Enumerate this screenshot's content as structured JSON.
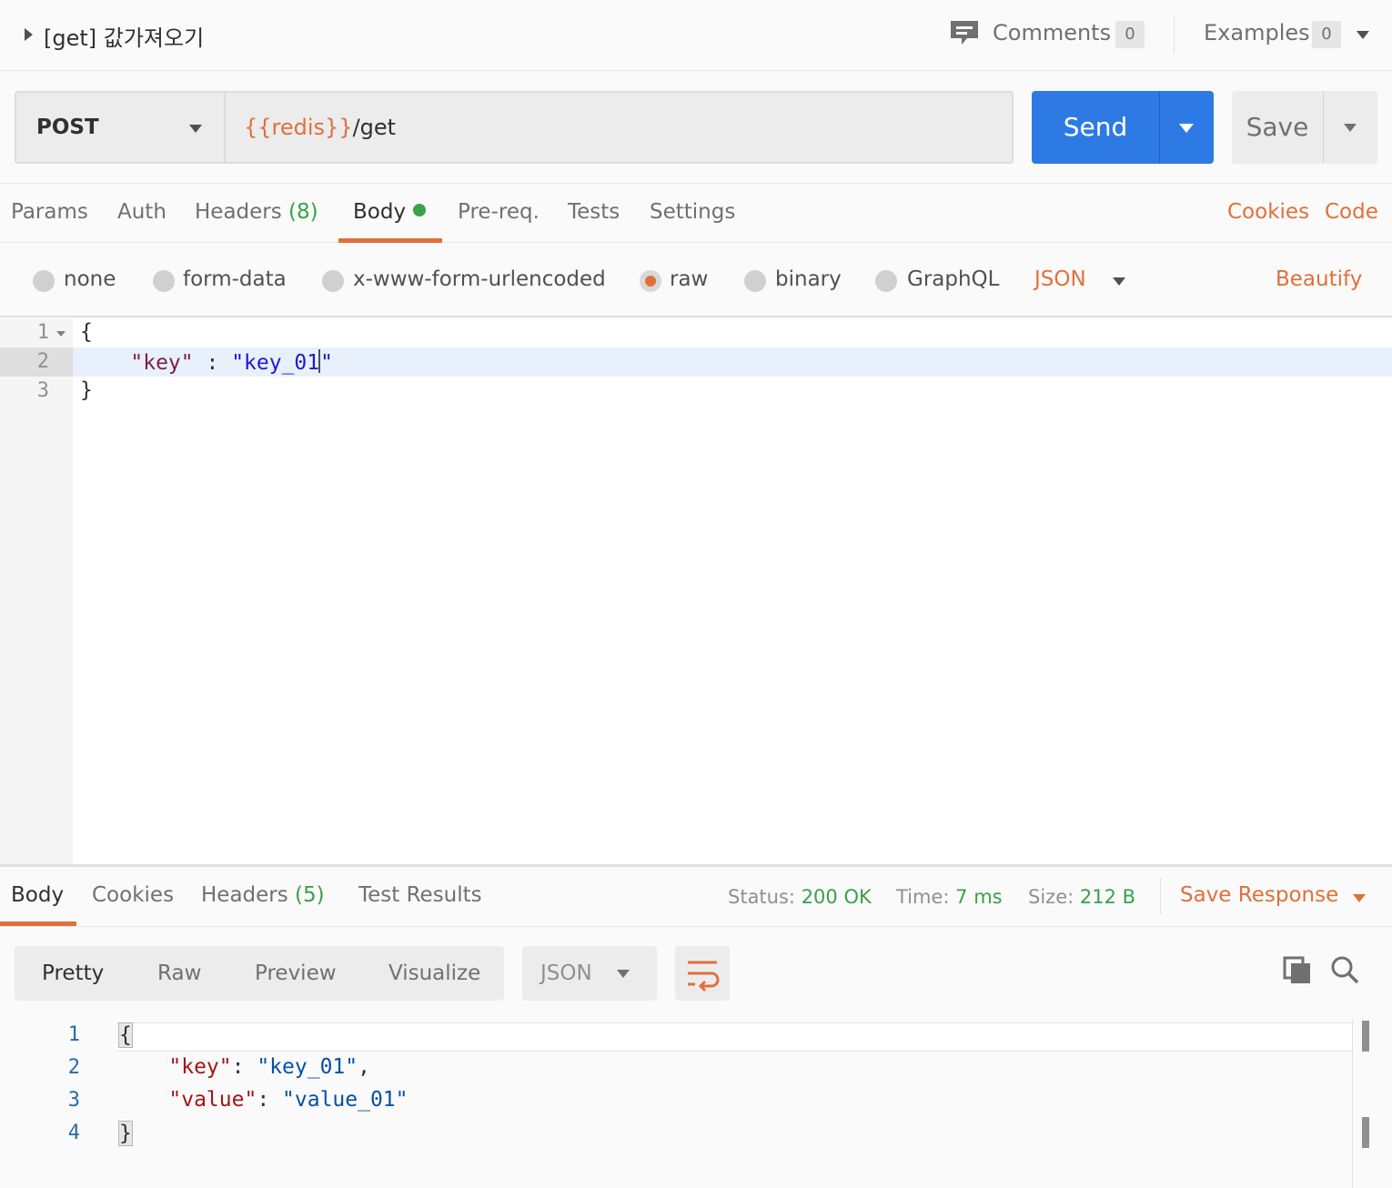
{
  "title_bar": {
    "title": "[get] 값가져오기",
    "comments_label": "Comments",
    "comments_count": "0",
    "examples_label": "Examples",
    "examples_count": "0",
    "icons": [
      "expand-arrow-icon",
      "comment-icon",
      "chevron-down-icon"
    ]
  },
  "request": {
    "method": "POST",
    "url_variable": "{{redis}}",
    "url_path": "/get",
    "send_label": "Send",
    "save_label": "Save"
  },
  "request_tabs": {
    "params": "Params",
    "auth": "Auth",
    "headers": "Headers",
    "headers_count": "(8)",
    "body": "Body",
    "prereq": "Pre-req.",
    "tests": "Tests",
    "settings": "Settings",
    "active": "Body",
    "cookies_link": "Cookies",
    "code_link": "Code"
  },
  "body_types": {
    "options": [
      "none",
      "form-data",
      "x-www-form-urlencoded",
      "raw",
      "binary",
      "GraphQL"
    ],
    "selected": "raw",
    "format": "JSON",
    "beautify": "Beautify"
  },
  "request_body": {
    "line_numbers": [
      "1",
      "2",
      "3"
    ],
    "line1": "{",
    "line2_key": "\"key\"",
    "line2_sep": " : ",
    "line2_value": "\"key_01",
    "line2_close": "\"",
    "line3": "}"
  },
  "response_tabs": {
    "body": "Body",
    "cookies": "Cookies",
    "headers": "Headers",
    "headers_count": "(5)",
    "test_results": "Test Results",
    "active": "Body"
  },
  "response_status": {
    "status_label": "Status:",
    "status_value": "200 OK",
    "time_label": "Time:",
    "time_value": "7 ms",
    "size_label": "Size:",
    "size_value": "212 B",
    "save_response": "Save Response"
  },
  "response_view": {
    "tabs": [
      "Pretty",
      "Raw",
      "Preview",
      "Visualize"
    ],
    "active": "Pretty",
    "format": "JSON",
    "icons": [
      "wrap-lines-icon",
      "copy-icon",
      "search-icon"
    ]
  },
  "response_body": {
    "line_numbers": [
      "1",
      "2",
      "3",
      "4"
    ],
    "line1": "{",
    "key1": "\"key\"",
    "value1": "\"key_01\"",
    "key2": "\"value\"",
    "value2": "\"value_01\"",
    "line4": "}"
  },
  "colors": {
    "accent_orange": "#e0703b",
    "send_blue": "#2d7ae5",
    "success_green": "#3aa04a"
  }
}
